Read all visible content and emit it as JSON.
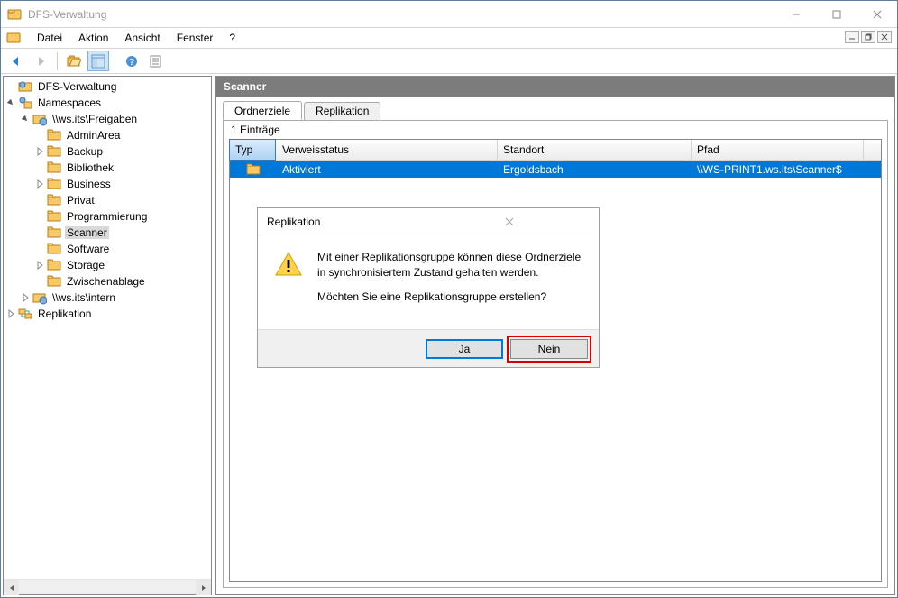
{
  "titlebar": {
    "title": "DFS-Verwaltung"
  },
  "menu": {
    "datei": "Datei",
    "aktion": "Aktion",
    "ansicht": "Ansicht",
    "fenster": "Fenster",
    "help": "?"
  },
  "tree": {
    "root": "DFS-Verwaltung",
    "namespaces": "Namespaces",
    "share1": "\\\\ws.its\\Freigaben",
    "items": {
      "adminarea": "AdminArea",
      "backup": "Backup",
      "bibliothek": "Bibliothek",
      "business": "Business",
      "privat": "Privat",
      "programmierung": "Programmierung",
      "scanner": "Scanner",
      "software": "Software",
      "storage": "Storage",
      "zwischen": "Zwischenablage"
    },
    "share2": "\\\\ws.its\\intern",
    "replication": "Replikation"
  },
  "content": {
    "header": "Scanner",
    "tab_ordnerziele": "Ordnerziele",
    "tab_replikation": "Replikation",
    "entries_label": "1 Einträge",
    "col_typ": "Typ",
    "col_verweis": "Verweisstatus",
    "col_standort": "Standort",
    "col_pfad": "Pfad",
    "row": {
      "verweis": "Aktiviert",
      "standort": "Ergoldsbach",
      "pfad": "\\\\WS-PRINT1.ws.its\\Scanner$"
    }
  },
  "dialog": {
    "title": "Replikation",
    "line1": "Mit einer Replikationsgruppe können diese Ordnerziele in synchronisiertem Zustand gehalten werden.",
    "line2": "Möchten Sie eine Replikationsgruppe erstellen?",
    "ja": "Ja",
    "nein": "Nein"
  }
}
